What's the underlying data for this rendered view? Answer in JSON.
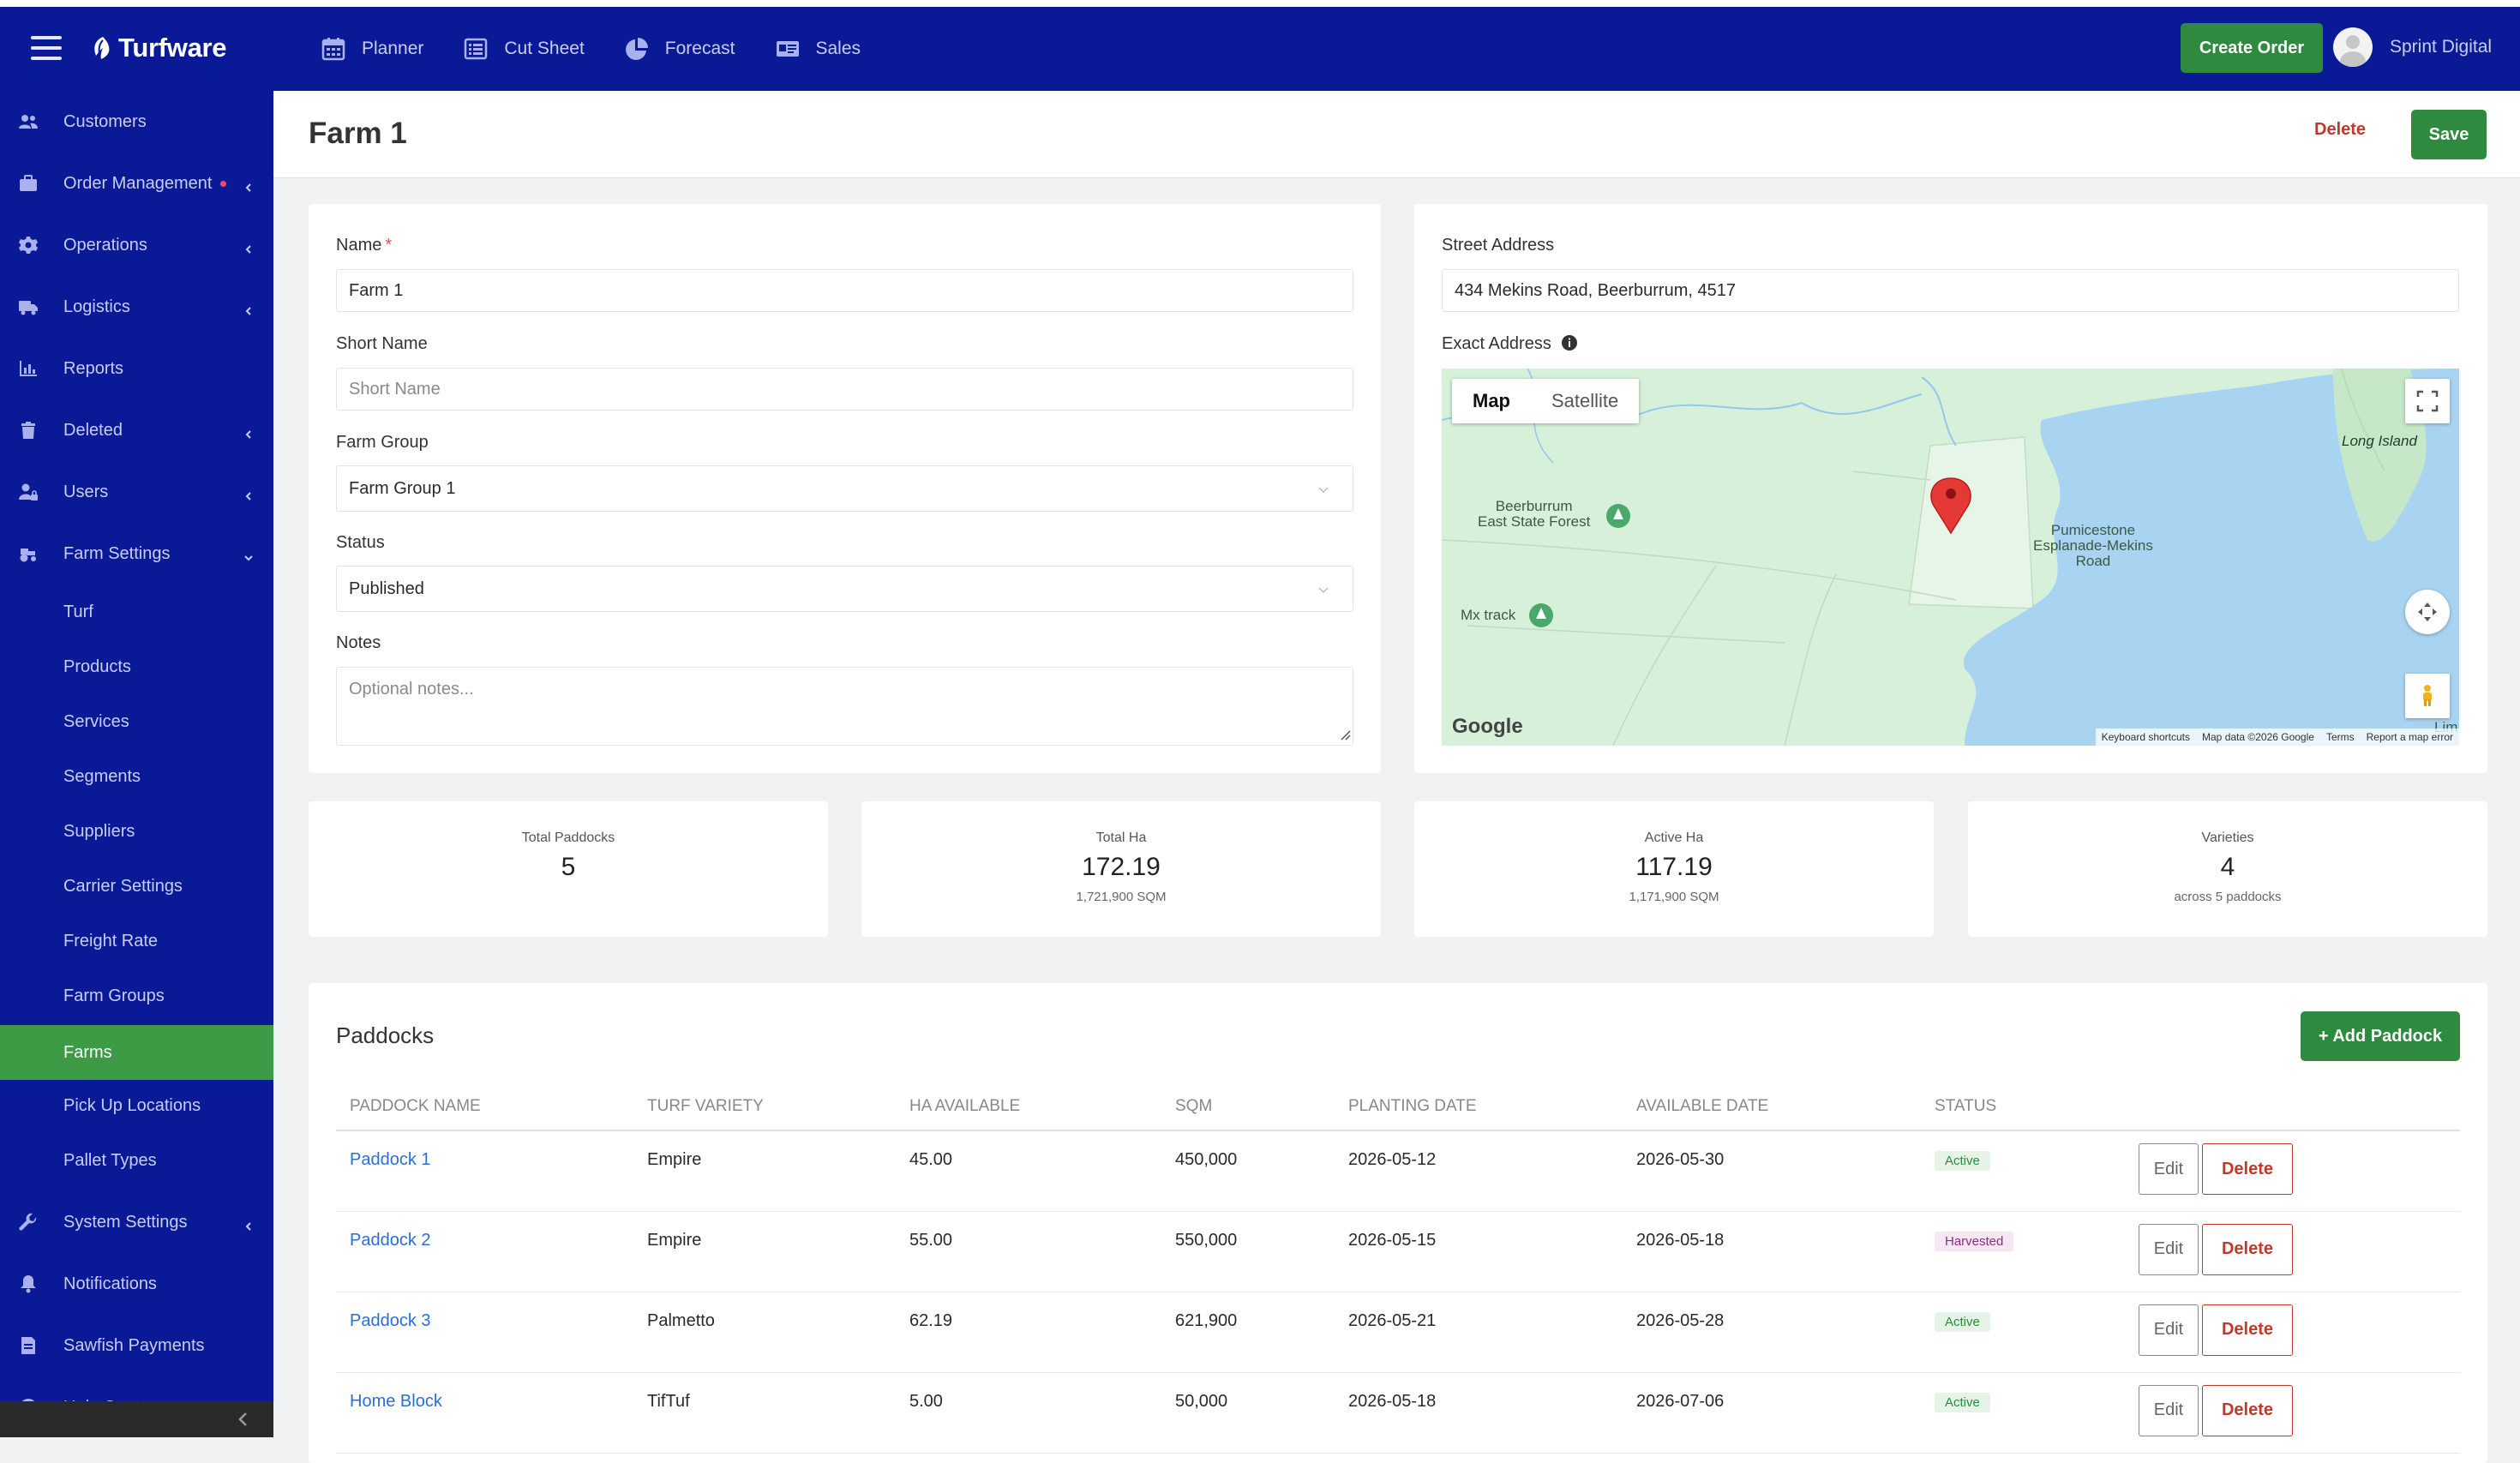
{
  "app": {
    "brand": "Turfware",
    "colors": {
      "nav_bg": "#0a1a97",
      "accent": "#2d8a3e",
      "danger": "#c0392b",
      "link": "#2b6fd6"
    }
  },
  "topnav": {
    "items": [
      {
        "label": "Planner",
        "icon": "calendar-icon"
      },
      {
        "label": "Cut Sheet",
        "icon": "list-icon"
      },
      {
        "label": "Forecast",
        "icon": "pie-chart-icon"
      },
      {
        "label": "Sales",
        "icon": "id-card-icon"
      }
    ],
    "create_order_label": "Create Order",
    "user_name": "Sprint Digital"
  },
  "sidebar": {
    "items": [
      {
        "label": "Customers",
        "icon": "users-icon",
        "chevron": false
      },
      {
        "label": "Order Management",
        "icon": "briefcase-icon",
        "chevron": true,
        "dot": true
      },
      {
        "label": "Operations",
        "icon": "gear-icon",
        "chevron": true
      },
      {
        "label": "Logistics",
        "icon": "truck-icon",
        "chevron": true
      },
      {
        "label": "Reports",
        "icon": "bar-chart-icon",
        "chevron": false
      },
      {
        "label": "Deleted",
        "icon": "trash-icon",
        "chevron": true
      },
      {
        "label": "Users",
        "icon": "user-lock-icon",
        "chevron": true
      },
      {
        "label": "Farm Settings",
        "icon": "tractor-icon",
        "chevron": true,
        "expanded": true
      }
    ],
    "farm_settings_sub": [
      "Turf",
      "Products",
      "Services",
      "Segments",
      "Suppliers",
      "Carrier Settings",
      "Freight Rate",
      "Farm Groups",
      "Farms",
      "Pick Up Locations",
      "Pallet Types"
    ],
    "active_sub": "Farms",
    "lower_items": [
      {
        "label": "System Settings",
        "icon": "wrench-icon",
        "chevron": true
      },
      {
        "label": "Notifications",
        "icon": "bell-icon",
        "chevron": false
      },
      {
        "label": "Sawfish Payments",
        "icon": "receipt-icon",
        "chevron": false
      },
      {
        "label": "Help Centre",
        "icon": "info-icon",
        "chevron": false
      }
    ]
  },
  "page": {
    "title": "Farm 1",
    "delete_label": "Delete",
    "save_label": "Save"
  },
  "form": {
    "name_label": "Name",
    "name_required": "*",
    "name_value": "Farm 1",
    "short_name_label": "Short Name",
    "short_name_placeholder": "Short Name",
    "farm_group_label": "Farm Group",
    "farm_group_value": "Farm Group 1",
    "status_label": "Status",
    "status_value": "Published",
    "notes_label": "Notes",
    "notes_placeholder": "Optional notes..."
  },
  "address": {
    "street_label": "Street Address",
    "street_value": "434 Mekins Road, Beerburrum, 4517",
    "exact_label": "Exact Address"
  },
  "map": {
    "tabs": [
      "Map",
      "Satellite"
    ],
    "active_tab": "Map",
    "places": [
      "Beerburrum",
      "East State Forest",
      "Mx track",
      "Pumicestone",
      "Esplanade-Mekins",
      "Road",
      "Long Island",
      "Lim"
    ],
    "provider": "Google",
    "footer": [
      "Keyboard shortcuts",
      "Map data ©2026 Google",
      "Terms",
      "Report a map error"
    ]
  },
  "stats": [
    {
      "label": "Total Paddocks",
      "value": "5",
      "sub": ""
    },
    {
      "label": "Total Ha",
      "value": "172.19",
      "sub": "1,721,900 SQM"
    },
    {
      "label": "Active Ha",
      "value": "117.19",
      "sub": "1,171,900 SQM"
    },
    {
      "label": "Varieties",
      "value": "4",
      "sub": "across 5 paddocks"
    }
  ],
  "paddocks": {
    "title": "Paddocks",
    "add_label": "+ Add Paddock",
    "columns": [
      "Paddock Name",
      "Turf Variety",
      "HA Available",
      "SQM",
      "Planting Date",
      "Available Date",
      "Status"
    ],
    "edit_label": "Edit",
    "delete_label": "Delete",
    "rows": [
      {
        "name": "Paddock 1",
        "variety": "Empire",
        "ha": "45.00",
        "sqm": "450,000",
        "planting": "2026-05-12",
        "available": "2026-05-30",
        "status": "Active"
      },
      {
        "name": "Paddock 2",
        "variety": "Empire",
        "ha": "55.00",
        "sqm": "550,000",
        "planting": "2026-05-15",
        "available": "2026-05-18",
        "status": "Harvested"
      },
      {
        "name": "Paddock 3",
        "variety": "Palmetto",
        "ha": "62.19",
        "sqm": "621,900",
        "planting": "2026-05-21",
        "available": "2026-05-28",
        "status": "Active"
      },
      {
        "name": "Home Block",
        "variety": "TifTuf",
        "ha": "5.00",
        "sqm": "50,000",
        "planting": "2026-05-18",
        "available": "2026-07-06",
        "status": "Active"
      }
    ]
  }
}
